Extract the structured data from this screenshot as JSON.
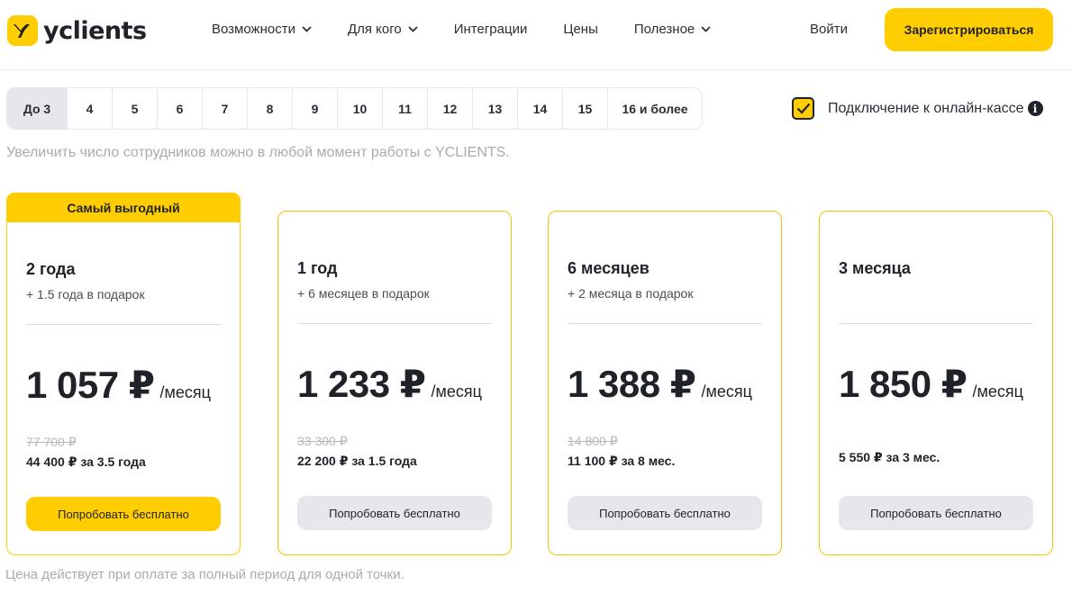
{
  "header": {
    "logo_text": "yclients",
    "nav": [
      {
        "label": "Возможности",
        "dropdown": true
      },
      {
        "label": "Для кого",
        "dropdown": true
      },
      {
        "label": "Интеграции",
        "dropdown": false
      },
      {
        "label": "Цены",
        "dropdown": false
      },
      {
        "label": "Полезное",
        "dropdown": true
      }
    ],
    "login_label": "Войти",
    "register_label": "Зарегистрироваться"
  },
  "employees": {
    "options": [
      "До 3",
      "4",
      "5",
      "6",
      "7",
      "8",
      "9",
      "10",
      "11",
      "12",
      "13",
      "14",
      "15",
      "16 и более"
    ],
    "selected": "До 3",
    "hint": "Увеличить число сотрудников можно в любой момент работы с YCLIENTS."
  },
  "kassa": {
    "label": "Подключение к онлайн-кассе",
    "checked": true,
    "info_glyph": "i"
  },
  "plans": [
    {
      "badge": "Самый выгодный",
      "period": "2 года",
      "bonus": "+ 1.5 года в подарок",
      "price": "1 057 ₽",
      "unit": "/месяц",
      "old_price": "77 700 ₽",
      "total": "44 400 ₽ за 3.5 года",
      "button": "Попробовать бесплатно"
    },
    {
      "period": "1 год",
      "bonus": "+ 6 месяцев в подарок",
      "price": "1 233 ₽",
      "unit": "/месяц",
      "old_price": "33 300 ₽",
      "total": "22 200 ₽ за 1.5 года",
      "button": "Попробовать бесплатно"
    },
    {
      "period": "6 месяцев",
      "bonus": "+ 2 месяца в подарок",
      "price": "1 388 ₽",
      "unit": "/месяц",
      "old_price": "14 800 ₽",
      "total": "11 100 ₽ за 8 мес.",
      "button": "Попробовать бесплатно"
    },
    {
      "period": "3 месяца",
      "price": "1 850 ₽",
      "unit": "/месяц",
      "total": "5 550 ₽ за 3 мес.",
      "button": "Попробовать бесплатно"
    }
  ],
  "footnote": "Цена действует при оплате за полный период для одной точки.",
  "colors": {
    "accent": "#ffcd00",
    "text": "#1f2229",
    "muted": "#a9abb2",
    "secondary_button": "#e6e7ed"
  }
}
